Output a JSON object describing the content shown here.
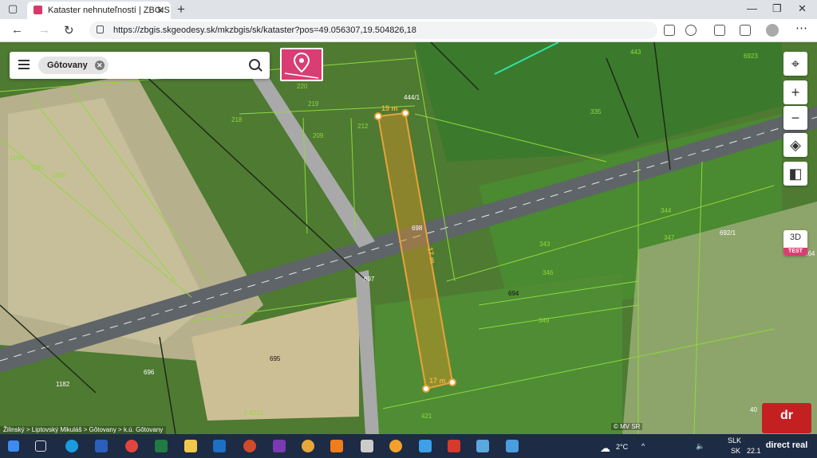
{
  "browser": {
    "tab_title": "Kataster nehnuteľností | ZBGIS",
    "url": "https://zbgis.skgeodesy.sk/mkzbgis/sk/kataster?pos=49.056307,19.504826,18"
  },
  "map": {
    "search_chip": "Gôtovany",
    "parcel_labels": [
      {
        "text": "220"
      },
      {
        "text": "219"
      },
      {
        "text": "218"
      },
      {
        "text": "212"
      },
      {
        "text": "444/1"
      },
      {
        "text": "335"
      },
      {
        "text": "443"
      },
      {
        "text": "6923"
      },
      {
        "text": "1190"
      },
      {
        "text": "1181"
      },
      {
        "text": "1187"
      },
      {
        "text": "209"
      },
      {
        "text": "698"
      },
      {
        "text": "697"
      },
      {
        "text": "343"
      },
      {
        "text": "346"
      },
      {
        "text": "694"
      },
      {
        "text": "349"
      },
      {
        "text": "344"
      },
      {
        "text": "347"
      },
      {
        "text": "692/1"
      },
      {
        "text": "264"
      },
      {
        "text": "695"
      },
      {
        "text": "696"
      },
      {
        "text": "1182"
      },
      {
        "text": "421"
      },
      {
        "text": "3-4212"
      },
      {
        "text": "40"
      }
    ],
    "measurements": {
      "top_edge": "15 m",
      "side": "17 m",
      "bottom_edge": "17 m"
    },
    "zoom_in": "+",
    "zoom_out": "−",
    "mode_3d": "3D",
    "test_badge": "TEST",
    "breadcrumb": "Žilinský > Liptovský Mikuláš > Gôtovany > k.ú. Gôtovany",
    "copyright": "© MV SR"
  },
  "taskbar": {
    "temperature": "2°C",
    "lang1": "SLK",
    "lang2": "SK",
    "date": "22.1"
  },
  "logo": {
    "text": "direct real"
  },
  "colors": {
    "parcel_line": "#8fd93c",
    "measure": "#e8a23a",
    "accent": "#d93d74"
  }
}
